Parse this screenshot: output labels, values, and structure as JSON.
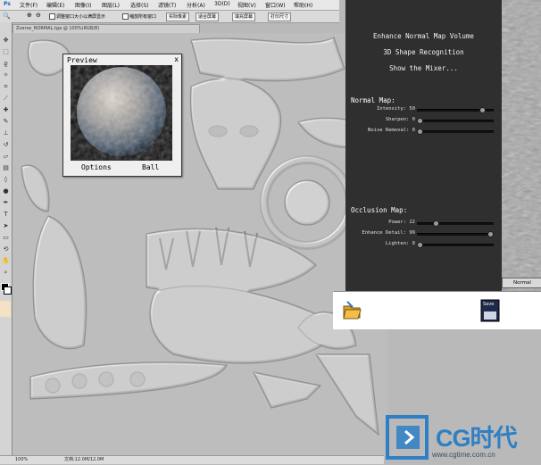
{
  "menubar": {
    "items": [
      "文件(F)",
      "编辑(E)",
      "图像(I)",
      "图层(L)",
      "选择(S)",
      "滤镜(T)",
      "分析(A)",
      "3D(D)",
      "视图(V)",
      "窗口(W)",
      "帮助(H)"
    ]
  },
  "options_bar": {
    "checkbox1": "调整窗口大小以满屏显示",
    "checkbox2": "缩放所有窗口",
    "btn_actual": "实际像素",
    "btn_fit": "适合屏幕",
    "btn_fill": "填充屏幕",
    "btn_print": "打印尺寸"
  },
  "document": {
    "tab": "Zverse_NORMAL.tga @ 100%(RGB/8)",
    "zoom": "100%",
    "status": "文档:12.0M/12.0M"
  },
  "preview": {
    "title": "Preview",
    "close": "x",
    "options": "Options",
    "mode": "Ball"
  },
  "panel": {
    "cmd1": "Enhance Normal Map Volume",
    "cmd2": "3D Shape Recognition",
    "cmd3": "Show the Mixer...",
    "normal_title": "Normal Map:",
    "normal_rows": [
      {
        "label": "Intensity: 50",
        "value": 0.88
      },
      {
        "label": "Sharpen: 0",
        "value": 0.0
      },
      {
        "label": "Noise Removal: 0",
        "value": 0.0
      }
    ],
    "occlusion_title": "Occlusion Map:",
    "occlusion_rows": [
      {
        "label": "Power: 22",
        "value": 0.22
      },
      {
        "label": "Enhance Detail: 99",
        "value": 0.99
      },
      {
        "label": "Lighten: 0",
        "value": 0.0
      }
    ],
    "normal_button": "Normal",
    "save_label": "Save"
  },
  "watermark": {
    "brand": "CG时代",
    "url": "www.cgtime.com.cn"
  },
  "colors": {
    "panel_bg": "#2f2f2f",
    "canvas": "#bdbdbd",
    "logo_blue": "#2e7fc3"
  }
}
